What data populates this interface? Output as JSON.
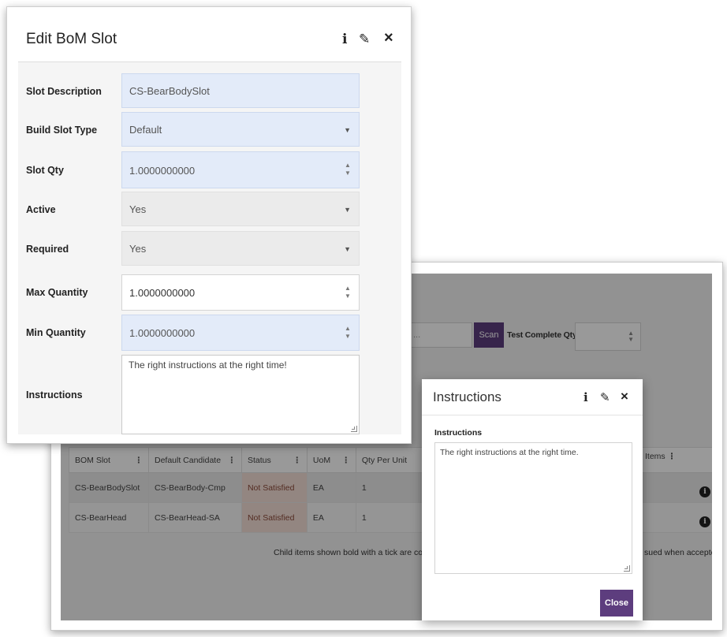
{
  "background": {
    "scan_placeholder": "...",
    "scan_label": "Scan",
    "test_complete_qty_label": "Test Complete Qty",
    "items_header": "Items",
    "table": {
      "headers": [
        "BOM Slot",
        "Default Candidate",
        "Status",
        "UoM",
        "Qty Per Unit"
      ],
      "rows": [
        [
          "CS-BearBodySlot",
          "CS-BearBody-Cmp",
          "Not Satisfied",
          "EA",
          "1"
        ],
        [
          "CS-BearHead",
          "CS-BearHead-SA",
          "Not Satisfied",
          "EA",
          "1"
        ]
      ]
    },
    "footnote_left": "Child items shown bold with a tick are confi",
    "footnote_right": "sued when accepte"
  },
  "instructions_dialog": {
    "title": "Instructions",
    "field_label": "Instructions",
    "text": "The right instructions at the right time.",
    "close_label": "Close"
  },
  "edit_dialog": {
    "title": "Edit BoM Slot",
    "fields": {
      "slot_description": {
        "label": "Slot Description",
        "value": "CS-BearBodySlot"
      },
      "build_slot_type": {
        "label": "Build Slot Type",
        "value": "Default"
      },
      "slot_qty": {
        "label": "Slot Qty",
        "value": "1.0000000000"
      },
      "active": {
        "label": "Active",
        "value": "Yes"
      },
      "required": {
        "label": "Required",
        "value": "Yes"
      },
      "max_quantity": {
        "label": "Max Quantity",
        "value": "1.0000000000"
      },
      "min_quantity": {
        "label": "Min Quantity",
        "value": "1.0000000000"
      },
      "instructions": {
        "label": "Instructions",
        "value": "The right instructions at the right time!"
      }
    }
  },
  "icons": {
    "info": "i",
    "edit": "✎",
    "close": "×",
    "caret": "▼",
    "spin_up": "▲",
    "spin_down": "▼"
  }
}
